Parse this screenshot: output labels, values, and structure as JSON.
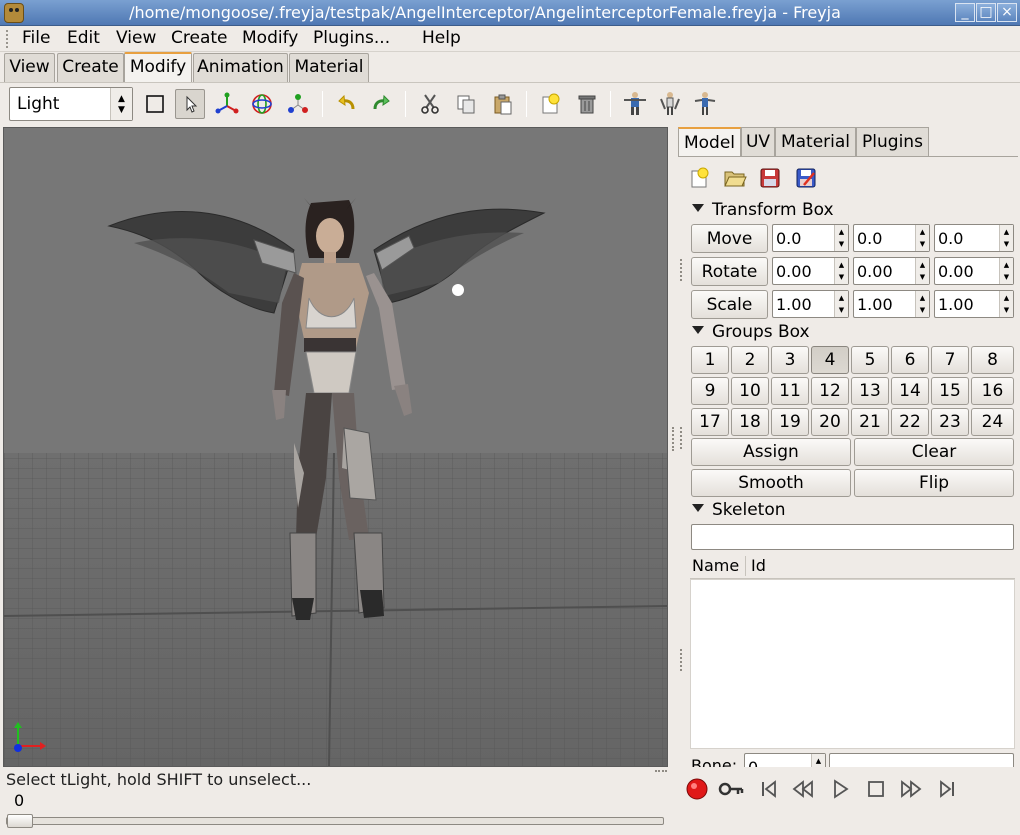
{
  "window": {
    "title": "/home/mongoose/.freyja/testpak/AngelInterceptor/AngelinterceptorFemale.freyja - Freyja",
    "minimize_glyph": "_",
    "maximize_glyph": "□",
    "close_glyph": "×"
  },
  "menu": [
    "File",
    "Edit",
    "View",
    "Create",
    "Modify",
    "Plugins...",
    "Help"
  ],
  "mode_tabs": [
    "View",
    "Create",
    "Modify",
    "Animation",
    "Material"
  ],
  "active_mode_tab": "Modify",
  "toolbar": {
    "mode_value": "Light",
    "icons": [
      "select-box-icon",
      "pointer-icon",
      "move-axes-icon",
      "rotate-rings-icon",
      "vertex-points-icon",
      "undo-icon",
      "redo-icon",
      "cut-icon",
      "copy-icon",
      "paste-icon",
      "new-icon",
      "delete-icon",
      "pose-icon-1",
      "pose-icon-2",
      "pose-icon-3"
    ]
  },
  "panel": {
    "tabs": [
      "Model",
      "UV",
      "Material",
      "Plugins"
    ],
    "active_tab": "Model",
    "file_icons": [
      "new-file-icon",
      "open-folder-icon",
      "save-icon",
      "save-as-icon"
    ],
    "transform": {
      "header": "Transform Box",
      "rows": [
        {
          "label": "Move",
          "values": [
            "0.0",
            "0.0",
            "0.0"
          ]
        },
        {
          "label": "Rotate",
          "values": [
            "0.00",
            "0.00",
            "0.00"
          ]
        },
        {
          "label": "Scale",
          "values": [
            "1.00",
            "1.00",
            "1.00"
          ]
        }
      ]
    },
    "groups": {
      "header": "Groups Box",
      "numbers": [
        "1",
        "2",
        "3",
        "4",
        "5",
        "6",
        "7",
        "8",
        "9",
        "10",
        "11",
        "12",
        "13",
        "14",
        "15",
        "16",
        "17",
        "18",
        "19",
        "20",
        "21",
        "22",
        "23",
        "24"
      ],
      "active": "4",
      "assign": "Assign",
      "clear": "Clear",
      "smooth": "Smooth",
      "flip": "Flip"
    },
    "skeleton": {
      "header": "Skeleton",
      "search_value": "",
      "col_name": "Name",
      "col_id": "Id",
      "bone_label": "Bone:",
      "bone_value": "0"
    }
  },
  "status": {
    "text": "Select tLight, hold SHIFT to unselect...",
    "frame": "0",
    "timeline_position": 0
  },
  "colors": {
    "viewport_sky": "#777777",
    "viewport_floor": "#6a6a6a",
    "record": "#e01818"
  }
}
